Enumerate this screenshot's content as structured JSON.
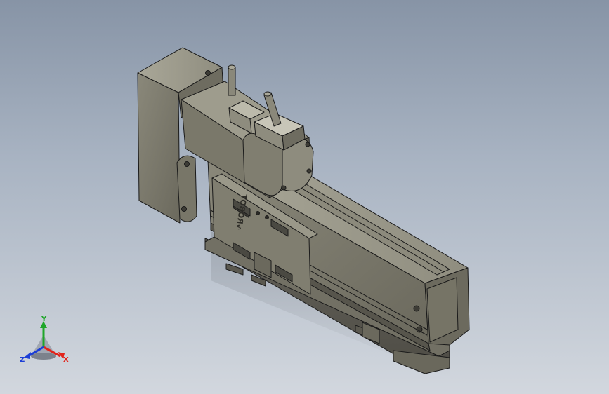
{
  "viewport": {
    "background_top": "#8794a6",
    "background_bottom": "#d2d7de"
  },
  "model": {
    "body_color": "#7c7a6c",
    "body_dark": "#5e5c51",
    "body_light": "#a19f90",
    "edge_color": "#1a1a1a",
    "logo_text": "∿ROBOT"
  },
  "triad": {
    "x_label": "X",
    "y_label": "Y",
    "z_label": "Z",
    "x_color": "#e2231a",
    "y_color": "#1fa62a",
    "z_color": "#1c3ed6"
  }
}
